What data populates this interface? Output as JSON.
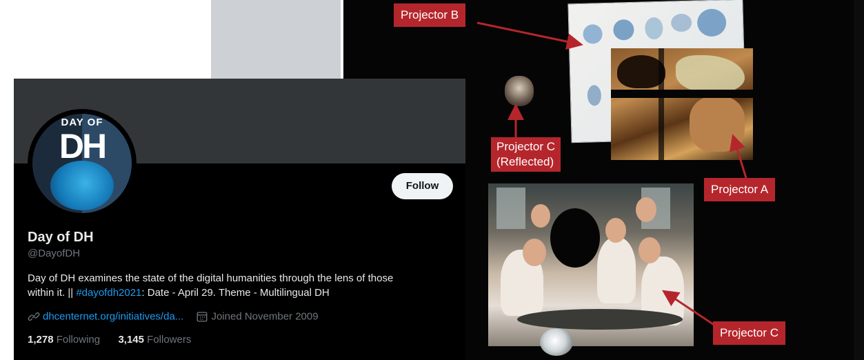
{
  "profile": {
    "avatar": {
      "top_text": "DAY OF",
      "main_text": "DH"
    },
    "follow_label": "Follow",
    "display_name": "Day of DH",
    "handle": "@DayofDH",
    "bio": {
      "line1": "Day of DH examines the state of the digital humanities through the lens of those",
      "line2_before": "within it. || ",
      "hashtag": "#dayofdh2021",
      "line2_after": ": Date - April 29. Theme - Multilingual DH"
    },
    "website": "dhcenternet.org/initiatives/da...",
    "joined": "Joined November 2009",
    "following_count": "1,278",
    "following_label": "Following",
    "followers_count": "3,145",
    "followers_label": "Followers"
  },
  "photo_labels": {
    "projector_b": "Projector B",
    "projector_a": "Projector A",
    "projector_c": "Projector C",
    "projector_c_reflected_line1": "Projector C",
    "projector_c_reflected_line2": "(Reflected)"
  },
  "colors": {
    "label_red": "#b5262c",
    "link_blue": "#1d9bf0",
    "banner_gray": "#333639",
    "page_gray_block": "#cdd1d5"
  },
  "icons": {
    "website": "link-icon",
    "joined": "calendar-icon"
  }
}
